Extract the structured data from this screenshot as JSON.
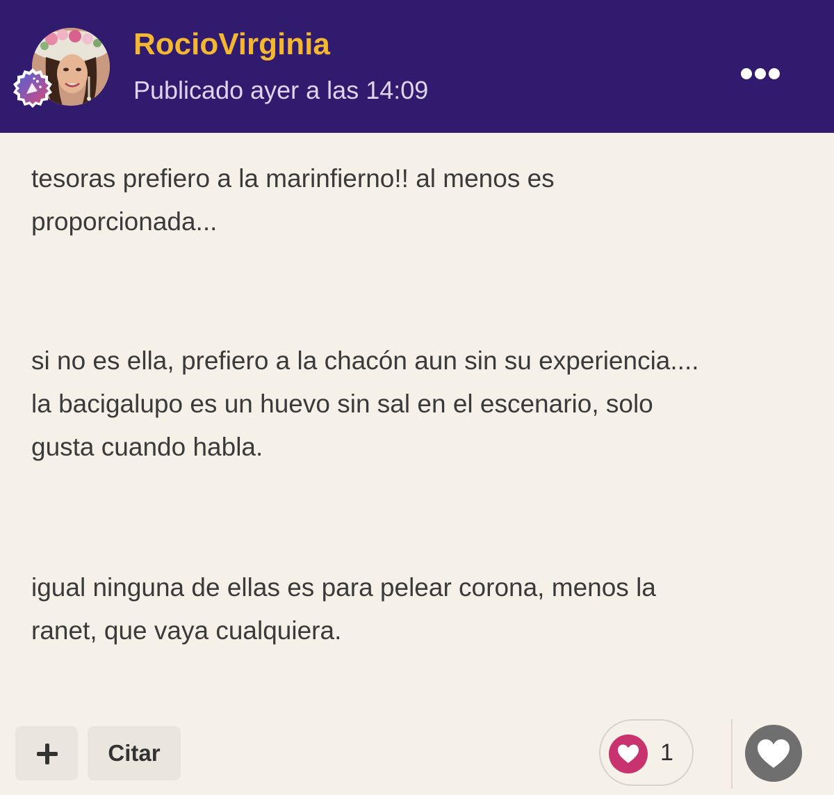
{
  "post": {
    "author": "RocioVirginia",
    "published": "Publicado ayer a las 14:09",
    "avatar_icon": "user-avatar",
    "badge_icon": "confetti-badge-icon",
    "more_icon": "more-dots-icon",
    "paragraphs": [
      "tesoras prefiero a la marinfierno!! al menos es\nproporcionada...",
      "si no es ella, prefiero a la chacón aun sin su experiencia....\nla bacigalupo es un huevo sin sal en el escenario, solo\ngusta cuando habla.",
      "igual ninguna de ellas es para pelear corona, menos la\nranet, que vaya cualquiera."
    ]
  },
  "footer": {
    "add_icon": "plus-icon",
    "quote_label": "Citar",
    "reaction_icon": "heart-icon",
    "reaction_count": "1",
    "like_icon": "heart-icon"
  },
  "colors": {
    "header_bg": "#311b6f",
    "author": "#f3b732",
    "timestamp": "#ddd6ee",
    "page_bg": "#f6f1e8",
    "reaction_heart": "#c8336f",
    "like_button": "#6f6f6f"
  }
}
